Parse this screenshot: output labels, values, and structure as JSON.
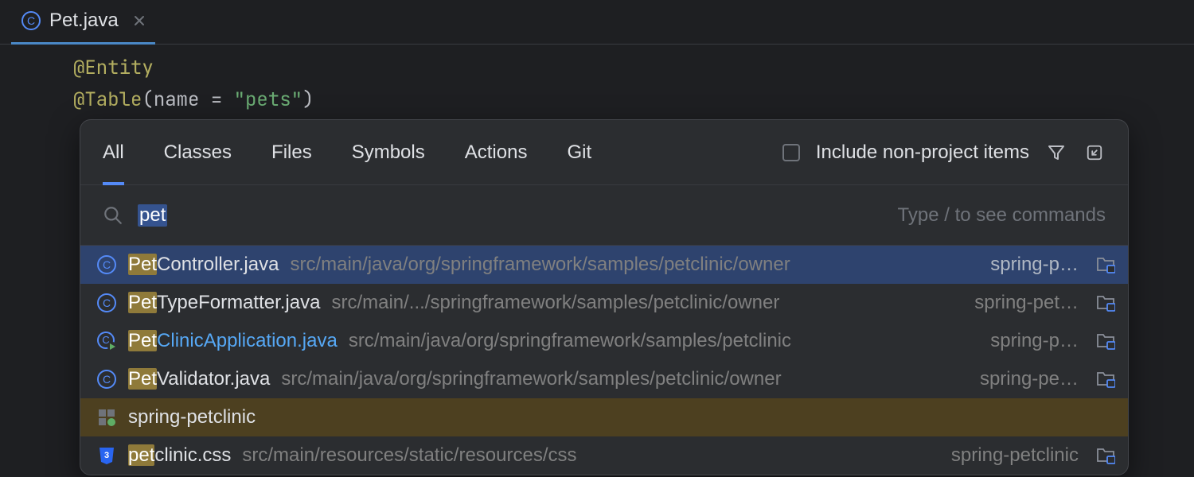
{
  "tab": {
    "filename": "Pet.java"
  },
  "code": {
    "line1_annotation": "@Entity",
    "line2_annotation": "@Table",
    "line2_paren_open": "(",
    "line2_key": "name",
    "line2_eq": " = ",
    "line2_value": "\"pets\"",
    "line2_paren_close": ")"
  },
  "popup": {
    "tabs": [
      "All",
      "Classes",
      "Files",
      "Symbols",
      "Actions",
      "Git"
    ],
    "include_label": "Include non-project items",
    "search_value": "pet",
    "hint": "Type / to see commands"
  },
  "results": [
    {
      "icon": "class",
      "name_match": "Pet",
      "name_rest": "Controller.java",
      "path": "src/main/java/org/springframework/samples/petclinic/owner",
      "module": "spring-p…",
      "selected": true,
      "suffix_icon": true
    },
    {
      "icon": "class",
      "name_match": "Pet",
      "name_rest": "TypeFormatter.java",
      "path": "src/main/.../springframework/samples/petclinic/owner",
      "module": "spring-pet…",
      "suffix_icon": true
    },
    {
      "icon": "class-run",
      "name_match": "Pet",
      "name_rest": "ClinicApplication.java",
      "path": "src/main/java/org/springframework/samples/petclinic",
      "module": "spring-p…",
      "blue": true,
      "suffix_icon": true
    },
    {
      "icon": "class",
      "name_match": "Pet",
      "name_rest": "Validator.java",
      "path": "src/main/java/org/springframework/samples/petclinic/owner",
      "module": "spring-pe…",
      "suffix_icon": true
    },
    {
      "icon": "project",
      "name_rest": "spring-petclinic",
      "project_row": true
    },
    {
      "icon": "css",
      "name_match": "pet",
      "name_rest": "clinic.css",
      "path": "src/main/resources/static/resources/css",
      "module": "spring-petclinic",
      "suffix_icon": true
    }
  ]
}
